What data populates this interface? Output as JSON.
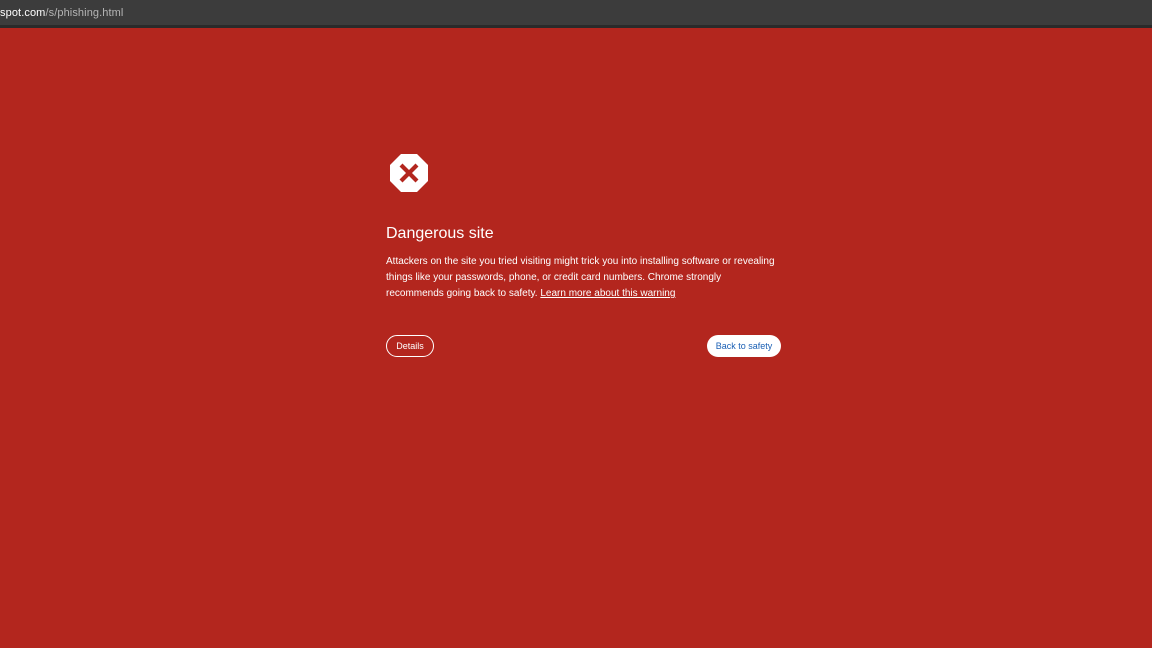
{
  "address_bar": {
    "host": "spot.com",
    "path": "/s/phishing.html"
  },
  "warning": {
    "icon": "stop-x-icon",
    "title": "Dangerous site",
    "body": "Attackers on the site you tried visiting might trick you into installing software or revealing things like your passwords, phone, or credit card numbers. Chrome strongly recommends going back to safety.",
    "learn_more_link": "Learn more about this warning"
  },
  "buttons": {
    "details_label": "Details",
    "back_label": "Back to safety"
  },
  "colors": {
    "background": "#b3261e",
    "topbar": "#3c3c3c",
    "button_text_blue": "#1a5fb4"
  }
}
